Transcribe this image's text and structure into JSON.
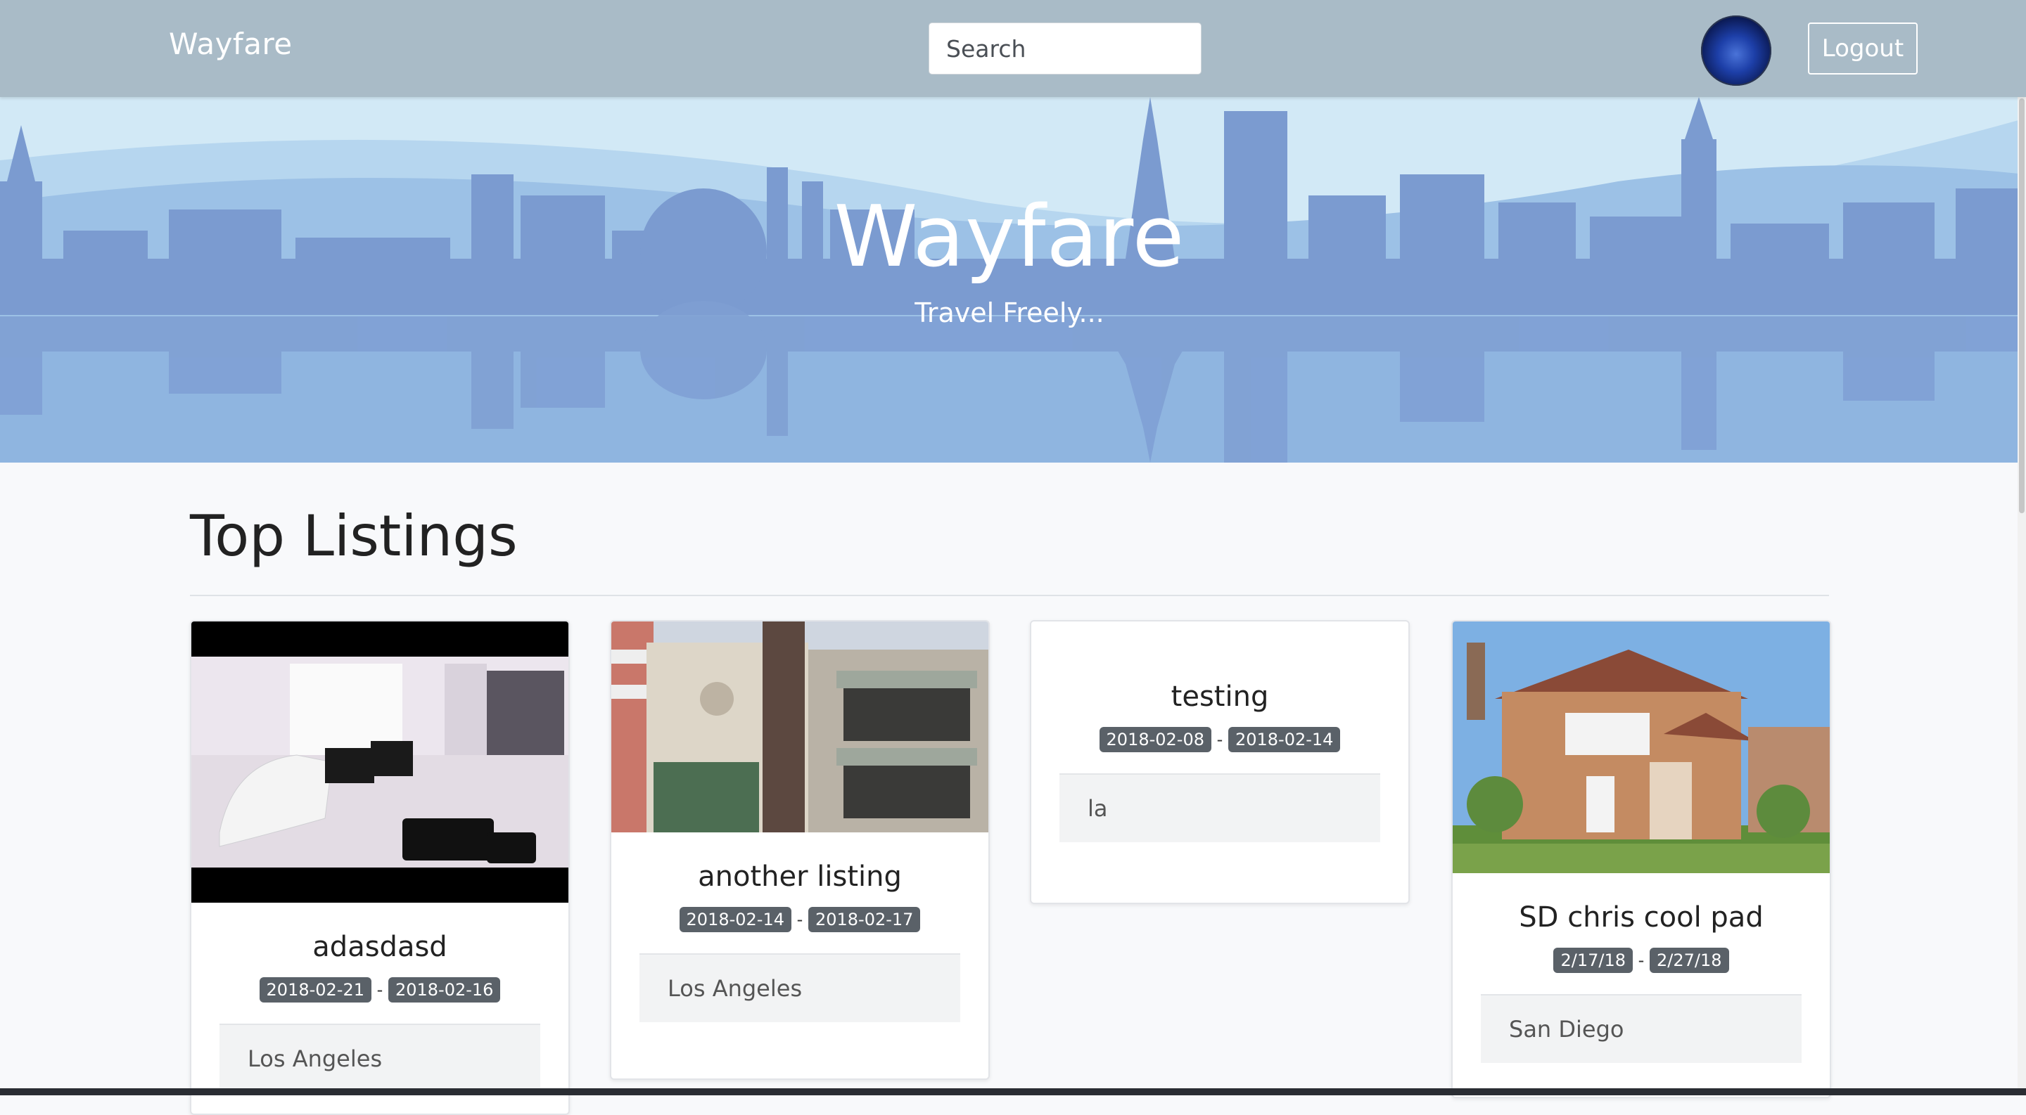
{
  "navbar": {
    "brand": "Wayfare",
    "search_placeholder": "Search",
    "logout_label": "Logout"
  },
  "hero": {
    "title": "Wayfare",
    "subtitle": "Travel Freely..."
  },
  "listings_section": {
    "title": "Top Listings"
  },
  "listings": [
    {
      "title": "adasdasd",
      "start": "2018-02-21",
      "end": "2018-02-16",
      "location": "Los Angeles"
    },
    {
      "title": "another listing",
      "start": "2018-02-14",
      "end": "2018-02-17",
      "location": "Los Angeles"
    },
    {
      "title": "testing",
      "start": "2018-02-08",
      "end": "2018-02-14",
      "location": "la"
    },
    {
      "title": "SD chris cool pad",
      "start": "2/17/18",
      "end": "2/27/18",
      "location": "San Diego"
    }
  ],
  "date_separator": "-",
  "colors": {
    "navbar": "#a9bbc7",
    "hero_sky": "#cfe7f4",
    "skyline": "#7b9bd0",
    "badge": "#5a6168"
  }
}
